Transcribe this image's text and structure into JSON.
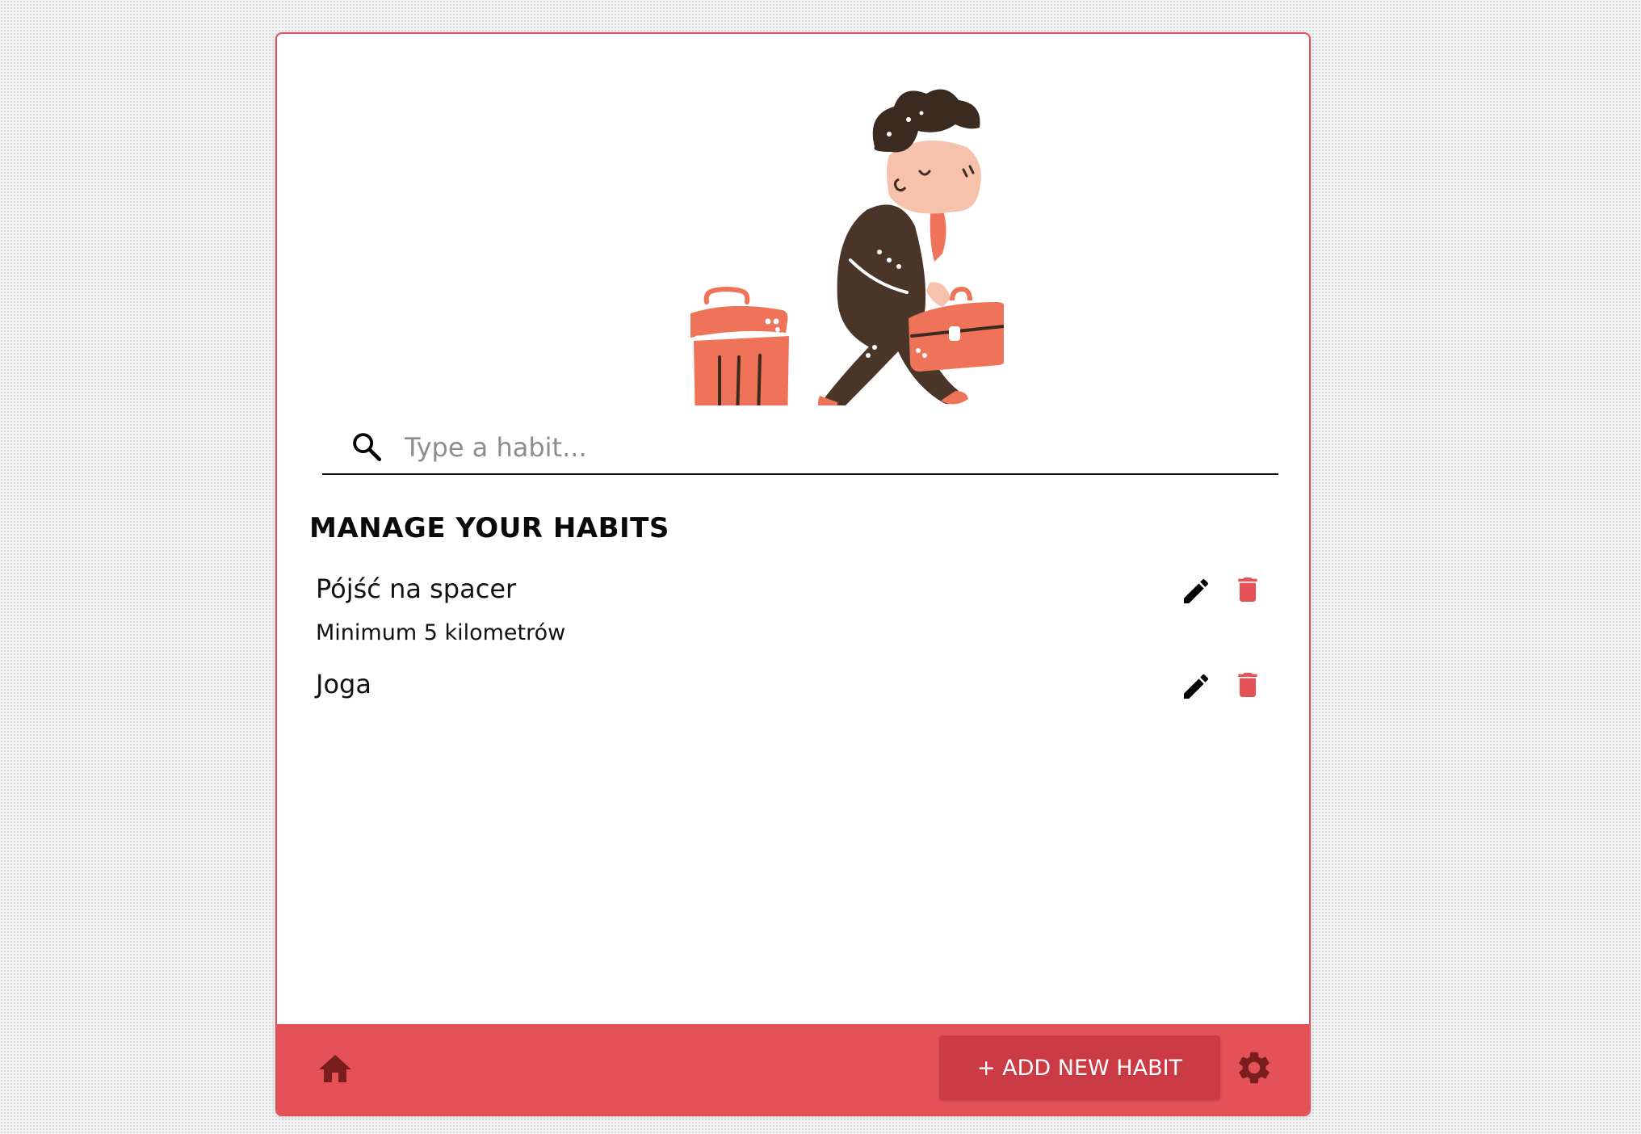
{
  "search": {
    "placeholder": "Type a habit..."
  },
  "section": {
    "title": "MANAGE YOUR HABITS"
  },
  "habits": [
    {
      "name": "Pójść na spacer",
      "description": "Minimum 5 kilometrów"
    },
    {
      "name": "Joga",
      "description": ""
    }
  ],
  "footer": {
    "add_label": "+ ADD NEW HABIT"
  },
  "icons": {
    "search": "search-icon",
    "edit": "pencil-icon",
    "delete": "trash-icon",
    "home": "home-icon",
    "settings": "gear-icon"
  },
  "colors": {
    "accent": "#e45258",
    "accent_dark": "#ca3b45",
    "icon_dark": "#7a1d1f",
    "delete_icon": "#e45258",
    "illustration_orange": "#ee7358",
    "illustration_brown": "#4a3628",
    "illustration_skin": "#f6c2ac"
  }
}
